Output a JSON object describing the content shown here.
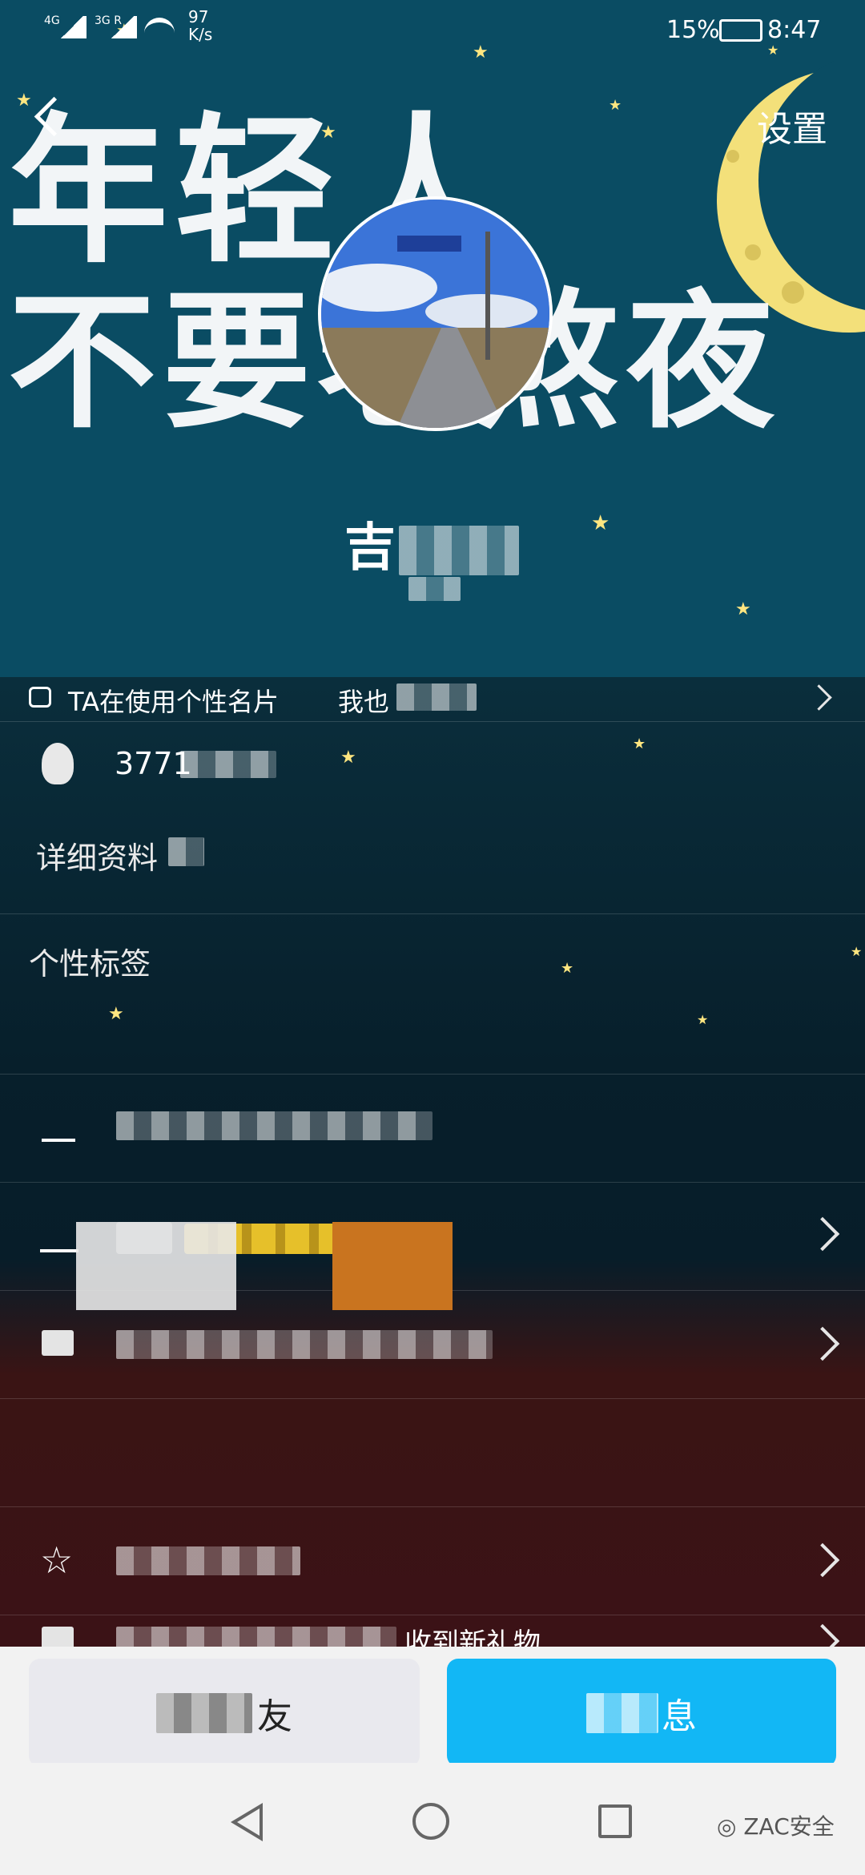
{
  "status_bar": {
    "network1": "4G",
    "network2": "3G R",
    "speed_value": "97",
    "speed_unit": "K/s",
    "battery": "15%",
    "time": "8:47"
  },
  "header": {
    "settings_label": "设置",
    "banner_line1": "年轻人",
    "banner_line2": "不要老熬夜",
    "nickname_visible": "吉"
  },
  "profile": {
    "theme_row_text": "TA在使用个性名片",
    "theme_row_action": "我也",
    "qq_number_visible": "3771",
    "details_label": "详细资料",
    "tags_label": "个性标签",
    "gift_row_tail": "收到新礼物"
  },
  "bottom_actions": {
    "left_button_tail": "友",
    "right_button_tail": "息"
  },
  "watermark": "ZAC安全",
  "colors": {
    "hero_bg": "#0a4c63",
    "send_button": "#12b7f5",
    "moon": "#f3e07a"
  },
  "icons": [
    "back-icon",
    "settings",
    "card-icon",
    "qq-penguin-icon",
    "edit-icon",
    "level-icon",
    "id-icon",
    "qzone-icon",
    "gift-icon",
    "chevron-right-icon",
    "nav-back-icon",
    "nav-home-icon",
    "nav-recent-icon"
  ]
}
